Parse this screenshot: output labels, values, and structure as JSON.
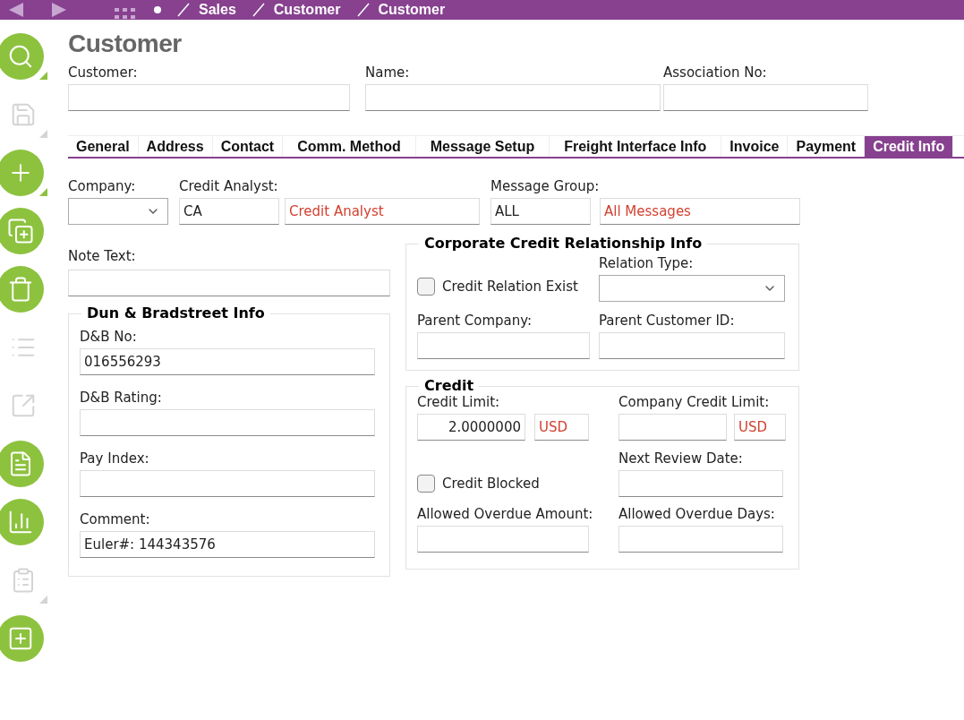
{
  "nav": {
    "breadcrumbs": [
      "Sales",
      "Customer",
      "Customer"
    ]
  },
  "toolbar": [
    {
      "kind": "search",
      "disabled": false,
      "menu": true
    },
    {
      "kind": "save",
      "disabled": true,
      "menu": true
    },
    {
      "kind": "add",
      "disabled": false,
      "menu": true
    },
    {
      "kind": "copy",
      "disabled": false,
      "menu": false
    },
    {
      "kind": "delete",
      "disabled": false,
      "menu": false
    },
    {
      "kind": "list",
      "disabled": true,
      "menu": false
    },
    {
      "kind": "open",
      "disabled": true,
      "menu": false
    },
    {
      "kind": "document",
      "disabled": false,
      "menu": false
    },
    {
      "kind": "chart",
      "disabled": false,
      "menu": false
    },
    {
      "kind": "info",
      "disabled": true,
      "menu": true
    },
    {
      "kind": "note",
      "disabled": false,
      "menu": false
    }
  ],
  "page_title": "Customer",
  "header": {
    "customer": {
      "label": "Customer:"
    },
    "name": {
      "label": "Name:"
    },
    "association": {
      "label": "Association No:"
    }
  },
  "tabs": [
    {
      "label": "General",
      "selected": false
    },
    {
      "label": "Address",
      "selected": false
    },
    {
      "label": "Contact",
      "selected": false
    },
    {
      "label": "Comm. Method",
      "selected": false
    },
    {
      "label": "Message Setup",
      "selected": false
    },
    {
      "label": "Freight Interface Info",
      "selected": false
    },
    {
      "label": "Invoice",
      "selected": false
    },
    {
      "label": "Payment",
      "selected": false
    },
    {
      "label": "Credit Info",
      "selected": true
    }
  ],
  "credit_info": {
    "company": {
      "label": "Company:"
    },
    "credit_analyst": {
      "label": "Credit Analyst:",
      "code": "CA",
      "description": "Credit Analyst"
    },
    "message_group": {
      "label": "Message Group:",
      "code": "ALL",
      "description": "All Messages"
    },
    "note_text": {
      "label": "Note Text:"
    },
    "dnb": {
      "title": "Dun & Bradstreet Info",
      "fields": [
        {
          "label": "D&B No:",
          "value": "016556293"
        },
        {
          "label": "D&B Rating:"
        },
        {
          "label": "Pay Index:"
        },
        {
          "label": "Comment:",
          "value": "Euler#: 144343576"
        }
      ]
    },
    "corporate": {
      "title": "Corporate Credit Relationship Info",
      "credit_relation_exist": {
        "label": "Credit Relation Exist",
        "checked": false
      },
      "relation_type": {
        "label": "Relation Type:"
      },
      "parent_company": {
        "label": "Parent Company:"
      },
      "parent_customer_id": {
        "label": "Parent Customer ID:"
      }
    },
    "credit": {
      "title": "Credit",
      "credit_limit": {
        "label": "Credit Limit:",
        "value": "2.0000000",
        "currency": "USD"
      },
      "company_credit_limit": {
        "label": "Company Credit Limit:",
        "currency": "USD"
      },
      "next_review_date": {
        "label": "Next Review Date:"
      },
      "credit_blocked": {
        "label": "Credit Blocked",
        "checked": false
      },
      "allowed_overdue_amount": {
        "label": "Allowed Overdue Amount:"
      },
      "allowed_overdue_days": {
        "label": "Allowed Overdue Days:"
      }
    }
  }
}
